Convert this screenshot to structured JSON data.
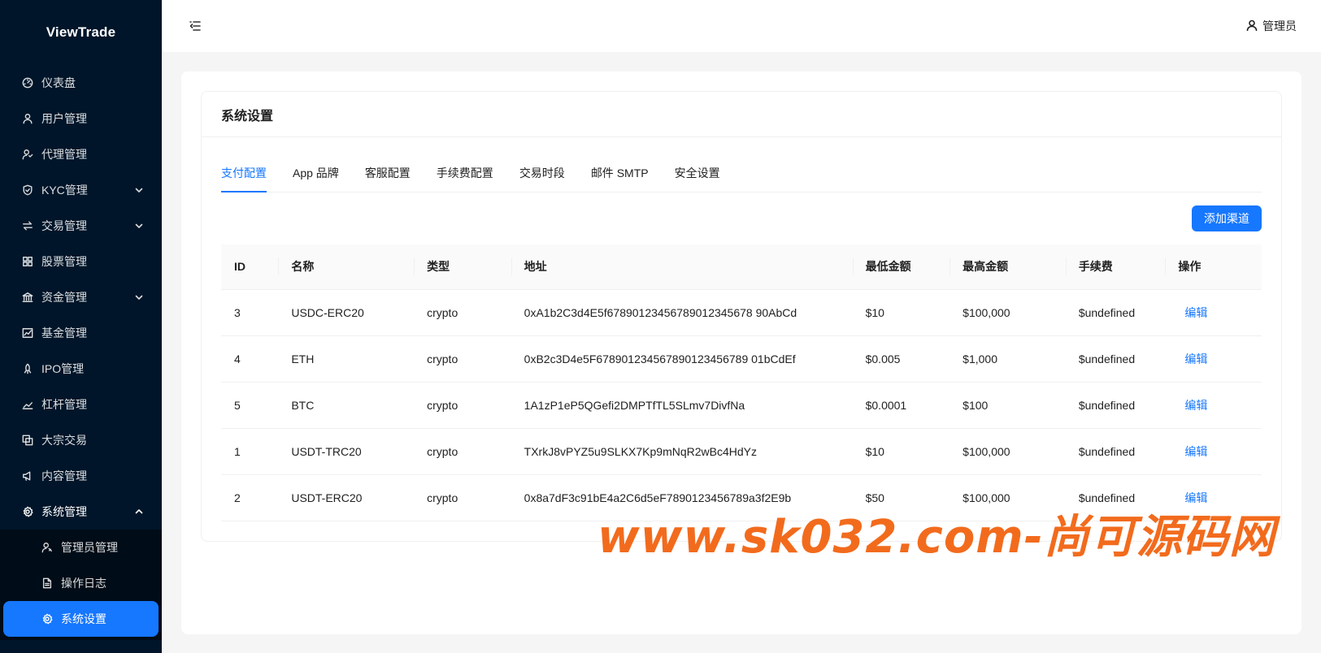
{
  "app": {
    "logo": "ViewTrade"
  },
  "sidebar": {
    "items": [
      {
        "label": "仪表盘",
        "icon": "dashboard-icon",
        "has_arrow": false
      },
      {
        "label": "用户管理",
        "icon": "user-icon",
        "has_arrow": false
      },
      {
        "label": "代理管理",
        "icon": "agent-icon",
        "has_arrow": false
      },
      {
        "label": "KYC管理",
        "icon": "shield-icon",
        "has_arrow": true
      },
      {
        "label": "交易管理",
        "icon": "swap-icon",
        "has_arrow": true
      },
      {
        "label": "股票管理",
        "icon": "grid-icon",
        "has_arrow": false
      },
      {
        "label": "资金管理",
        "icon": "bank-icon",
        "has_arrow": true
      },
      {
        "label": "基金管理",
        "icon": "fund-chart-icon",
        "has_arrow": false
      },
      {
        "label": "IPO管理",
        "icon": "rocket-icon",
        "has_arrow": false
      },
      {
        "label": "杠杆管理",
        "icon": "line-chart-icon",
        "has_arrow": false
      },
      {
        "label": "大宗交易",
        "icon": "block-icon",
        "has_arrow": false
      },
      {
        "label": "内容管理",
        "icon": "notification-icon",
        "has_arrow": false
      },
      {
        "label": "系统管理",
        "icon": "gear-icon",
        "has_arrow": true,
        "open": true
      }
    ],
    "submenu": [
      {
        "label": "管理员管理",
        "icon": "admin-icon"
      },
      {
        "label": "操作日志",
        "icon": "file-icon"
      },
      {
        "label": "系统设置",
        "icon": "gear-icon",
        "active": true
      }
    ]
  },
  "header": {
    "user_label": "管理员"
  },
  "card": {
    "title": "系统设置"
  },
  "tabs": [
    {
      "label": "支付配置",
      "active": true
    },
    {
      "label": "App 品牌"
    },
    {
      "label": "客服配置"
    },
    {
      "label": "手续费配置"
    },
    {
      "label": "交易时段"
    },
    {
      "label": "邮件 SMTP"
    },
    {
      "label": "安全设置"
    }
  ],
  "toolbar": {
    "add_button": "添加渠道"
  },
  "table": {
    "columns": [
      "ID",
      "名称",
      "类型",
      "地址",
      "最低金额",
      "最高金额",
      "手续费",
      "操作"
    ],
    "action_label": "编辑",
    "rows": [
      {
        "id": "3",
        "name": "USDC-ERC20",
        "type": "crypto",
        "address": "0xA1b2C3d4E5f67890123456789012345678 90AbCd",
        "min": "$10",
        "max": "$100,000",
        "fee": "$undefined"
      },
      {
        "id": "4",
        "name": "ETH",
        "type": "crypto",
        "address": "0xB2c3D4e5F678901234567890123456789 01bCdEf",
        "min": "$0.005",
        "max": "$1,000",
        "fee": "$undefined"
      },
      {
        "id": "5",
        "name": "BTC",
        "type": "crypto",
        "address": "1A1zP1eP5QGefi2DMPTfTL5SLmv7DivfNa",
        "min": "$0.0001",
        "max": "$100",
        "fee": "$undefined"
      },
      {
        "id": "1",
        "name": "USDT-TRC20",
        "type": "crypto",
        "address": "TXrkJ8vPYZ5u9SLKX7Kp9mNqR2wBc4HdYz",
        "min": "$10",
        "max": "$100,000",
        "fee": "$undefined"
      },
      {
        "id": "2",
        "name": "USDT-ERC20",
        "type": "crypto",
        "address": "0x8a7dF3c91bE4a2C6d5eF7890123456789a3f2E9b",
        "min": "$50",
        "max": "$100,000",
        "fee": "$undefined"
      }
    ]
  },
  "watermark": {
    "text": "www.sk032.com-尚可源码网"
  },
  "colors": {
    "sidebar_bg": "#001529",
    "accent": "#1677ff",
    "watermark": "#f26b1d"
  }
}
